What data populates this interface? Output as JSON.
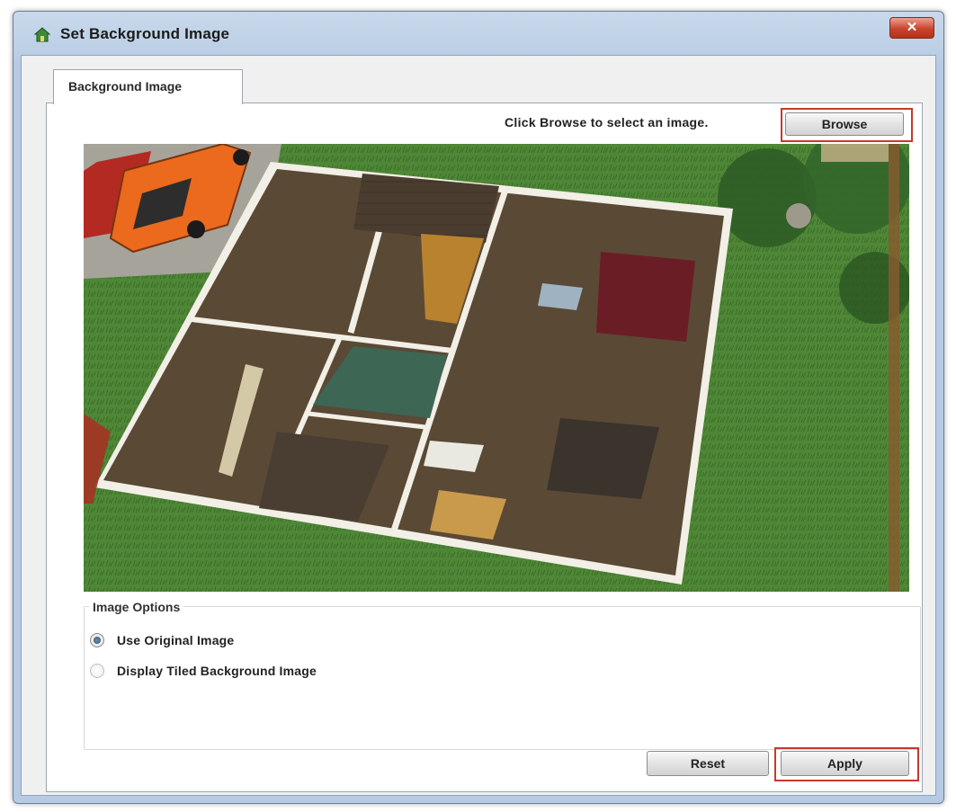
{
  "window": {
    "title": "Set Background Image",
    "close_glyph": "✕"
  },
  "tabs": [
    {
      "label": "Background Image"
    }
  ],
  "browse": {
    "hint": "Click Browse to select an image.",
    "button_label": "Browse"
  },
  "image_options": {
    "title": "Image Options",
    "options": [
      {
        "label": "Use Original Image",
        "selected": true
      },
      {
        "label": "Display Tiled Background Image",
        "selected": false
      }
    ]
  },
  "buttons": {
    "reset": "Reset",
    "apply": "Apply"
  },
  "colors": {
    "highlight": "#c6392c",
    "accent": "#2f4f73"
  },
  "icons": {
    "app": "home-designer-icon",
    "close": "close-icon"
  }
}
